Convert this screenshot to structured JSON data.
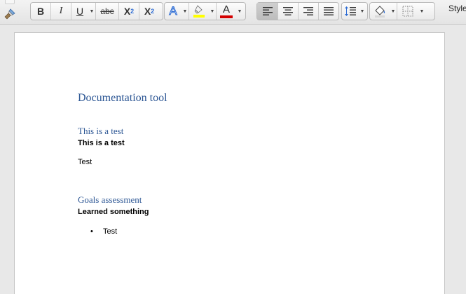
{
  "toolbar": {
    "bold_label": "B",
    "italic_label": "I",
    "underline_label": "U",
    "strikethrough_label": "abc",
    "subscript_label": "X",
    "subscript_index": "2",
    "superscript_label": "X",
    "superscript_index": "2",
    "text_effects_label": "A",
    "font_color_label": "A",
    "highlight_color": "#ffff00",
    "font_color": "#d40000",
    "styles_label": "Style"
  },
  "document": {
    "title": "Documentation tool",
    "section1": {
      "heading": "This is a test",
      "subheading": "This is a test",
      "body": "Test"
    },
    "section2": {
      "heading": "Goals assessment",
      "subheading": "Learned something",
      "bullet_marker": "•",
      "bullet_item": "Test"
    }
  }
}
